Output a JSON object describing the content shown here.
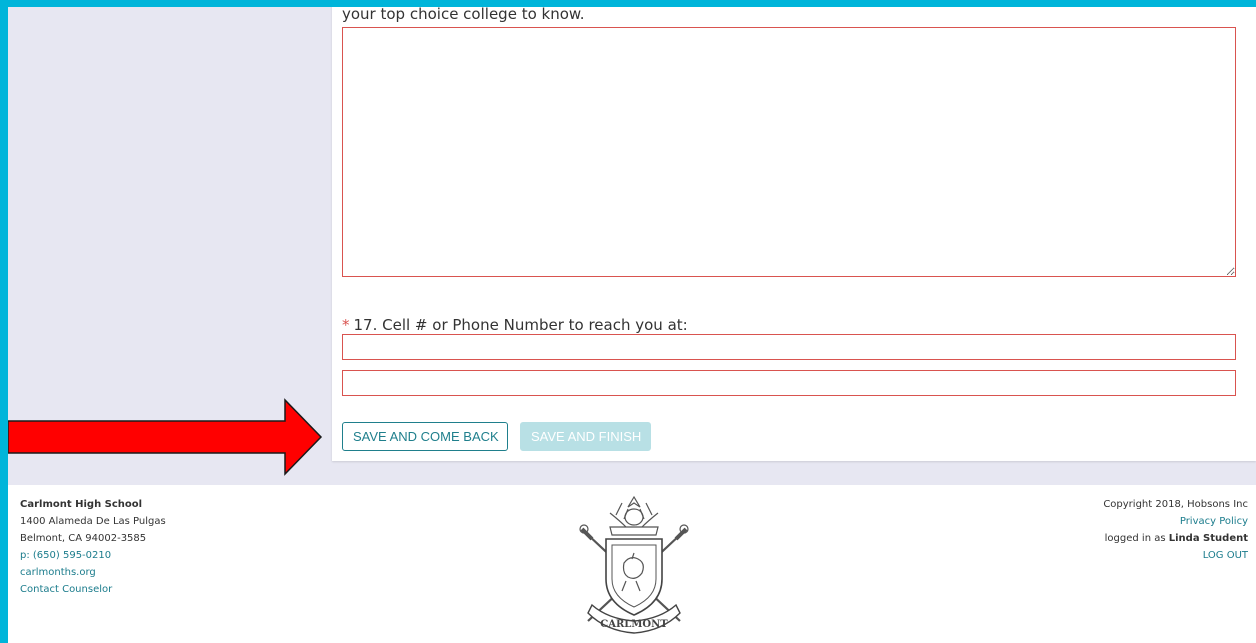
{
  "form": {
    "question_16_text": "your top choice college to know.",
    "essay_value": "",
    "question_17": {
      "required_marker": "*",
      "label": "17. Cell # or Phone Number to reach you at:",
      "field_1_value": "",
      "field_2_value": ""
    },
    "buttons": {
      "save_and_come_back": "SAVE AND COME BACK",
      "save_and_finish": "SAVE AND FINISH"
    }
  },
  "footer": {
    "school_name": "Carlmont High School",
    "address_line_1": "1400 Alameda De Las Pulgas",
    "address_line_2": "Belmont, CA 94002-3585",
    "phone": "p: (650) 595-0210",
    "website": "carlmonths.org",
    "contact_counselor": "Contact Counselor",
    "copyright": "Copyright 2018, Hobsons Inc",
    "privacy_policy": "Privacy Policy",
    "logged_in_prefix": "logged in as ",
    "user_name": "Linda Student",
    "logout": "LOG OUT",
    "crest_text": "CARLMONT",
    "crest_banner": "CARLMONT"
  },
  "icons": {
    "annotation_arrow": "red-arrow-icon",
    "crest": "carlmont-crest-icon"
  },
  "colors": {
    "frame": "#00b5da",
    "panel_bg": "#e7e7f2",
    "required": "#d9534f",
    "accent": "#1f7f8c",
    "disabled_button": "#b8e0e5",
    "arrow_red": "#ff0000"
  }
}
